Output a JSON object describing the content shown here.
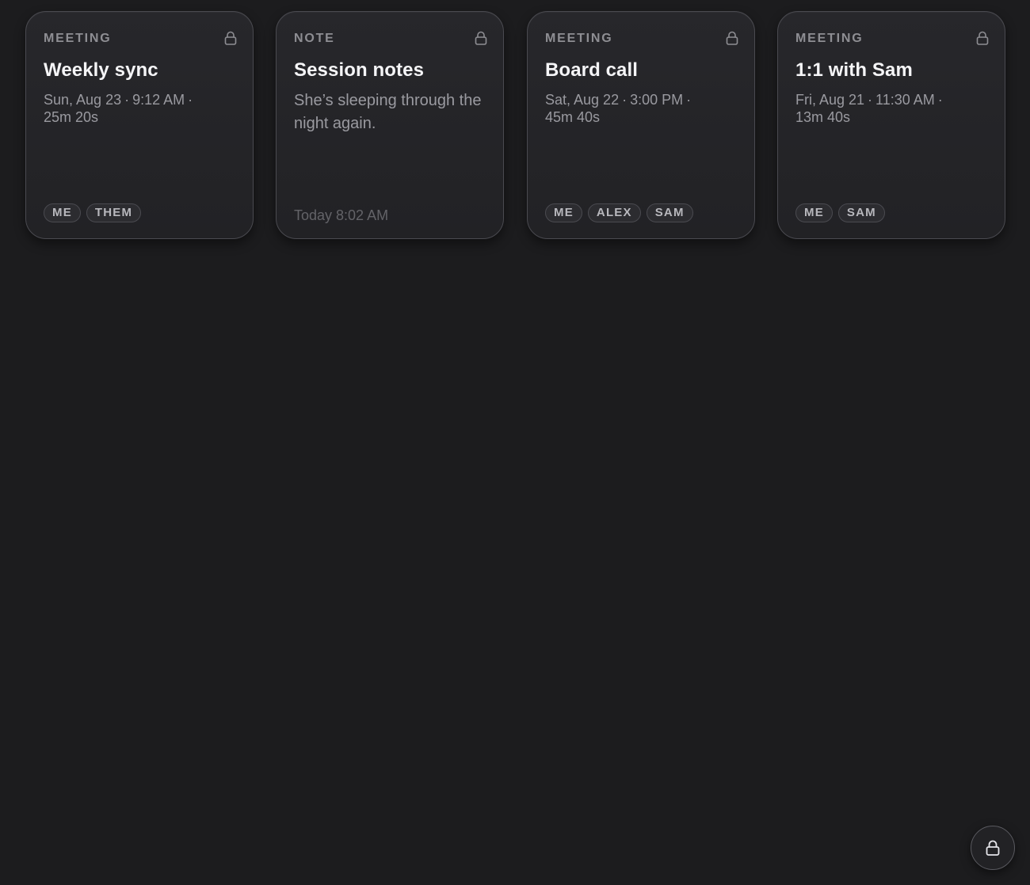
{
  "cards": [
    {
      "kind": "MEETING",
      "title": "Weekly sync",
      "date": "Sun, Aug 23",
      "time": "9:12 AM",
      "duration": "25m 20s",
      "participants": [
        "ME",
        "THEM"
      ]
    },
    {
      "kind": "NOTE",
      "title": "Session notes",
      "body": "She’s sleeping through the night again.",
      "timestamp": "Today 8:02 AM"
    },
    {
      "kind": "MEETING",
      "title": "Board call",
      "date": "Sat, Aug 22",
      "time": "3:00 PM",
      "duration": "45m 40s",
      "participants": [
        "ME",
        "ALEX",
        "SAM"
      ]
    },
    {
      "kind": "MEETING",
      "title": "1:1 with Sam",
      "date": "Fri, Aug 21",
      "time": "11:30 AM",
      "duration": "13m 40s",
      "participants": [
        "ME",
        "SAM"
      ]
    }
  ],
  "meta_separator": "·",
  "icons": {
    "card_lock": "lock-icon",
    "fab": "lock-icon"
  },
  "colors": {
    "background": "#1c1c1e",
    "card": "#252528",
    "card_border": "#4a4a50",
    "title": "#f5f5f7",
    "secondary": "#9a9aa0",
    "muted": "#636368"
  }
}
